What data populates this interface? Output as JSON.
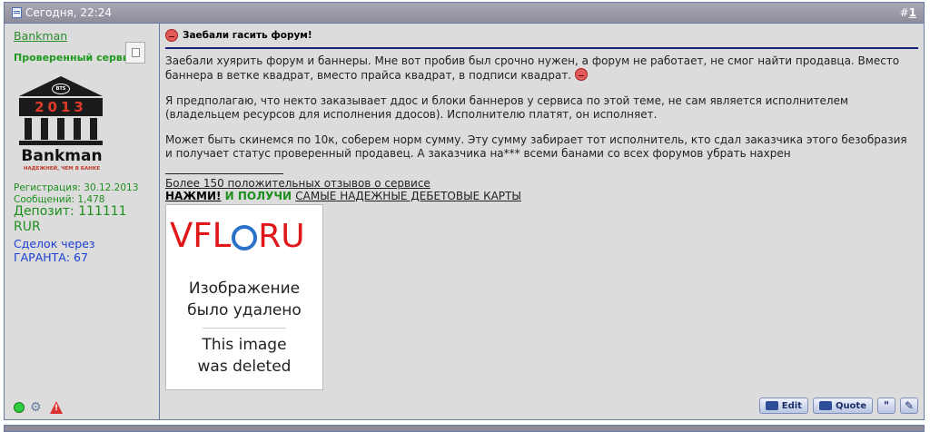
{
  "header": {
    "date": "Сегодня, 22:24",
    "post_number_prefix": "#",
    "post_number": "1"
  },
  "user": {
    "name": "Bankman",
    "title": "Проверенный сервис",
    "logo": {
      "badge": "BTS",
      "year": "2013",
      "name": "Bankman",
      "tagline": "НАДЕЖНЕЙ, ЧЕМ В БАНКЕ"
    },
    "registration": "Регистрация: 30.12.2013",
    "messages": "Сообщений: 1,478",
    "deposit": "Депозит: 111111 RUR",
    "deals_line1": "Сделок через",
    "deals_line2": "ГАРАНТА: 67"
  },
  "post": {
    "title": "Заебали гасить форум!",
    "paragraphs": [
      "Заебали хуярить форум и баннеры. Мне вот пробив был срочно нужен, а форум не работает, не смог найти продавца. Вместо баннера в ветке квадрат, вместо прайса квадрат, в подписи квадрат.",
      "Я предполагаю, что некто заказывает ддос и блоки баннеров у сервиса по этой теме, не сам является исполнителем (владельцем ресурсов для исполнения ддосов). Исполнителю платят, он исполняет.",
      "Может быть скинемся по 10к, соберем норм сумму. Эту сумму забирает тот исполнитель, кто сдал заказчика этого безобразия и получает статус проверенный продавец. А заказчика на*** всеми банами со всех форумов убрать нахрен"
    ]
  },
  "signature": {
    "reviews": "Более 150 положительных отзывов о сервисе",
    "press": "НАЖМИ!",
    "get": " И ПОЛУЧИ ",
    "cards": "САМЫЕ НАДЕЖНЫЕ ДЕБЕТОВЫЕ КАРТЫ",
    "image": {
      "brand_left": "VFL",
      "brand_right": "RU",
      "msg_ru_1": "Изображение",
      "msg_ru_2": "было удалено",
      "msg_en_1": "This image",
      "msg_en_2": "was deleted"
    }
  },
  "actions": {
    "edit": "Edit",
    "quote": "Quote",
    "multiquote": "\""
  }
}
